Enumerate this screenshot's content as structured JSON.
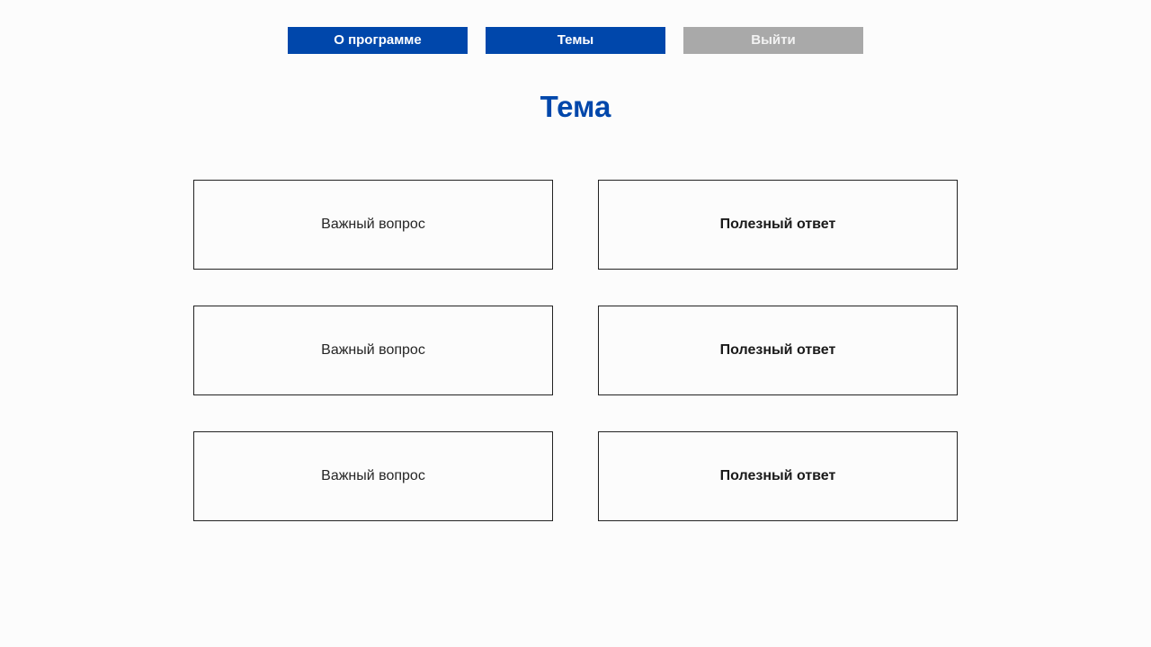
{
  "colors": {
    "primary": "#0047ab",
    "disabled": "#a9a9a9",
    "text": "#262626",
    "background": "#fcfcfc"
  },
  "nav": {
    "about_label": "О программе",
    "topics_label": "Темы",
    "logout_label": "Выйти"
  },
  "page": {
    "title": "Тема"
  },
  "qa": {
    "rows": [
      {
        "question": "Важный вопрос",
        "answer": "Полезный ответ"
      },
      {
        "question": "Важный вопрос",
        "answer": "Полезный ответ"
      },
      {
        "question": "Важный вопрос",
        "answer": "Полезный ответ"
      }
    ]
  }
}
